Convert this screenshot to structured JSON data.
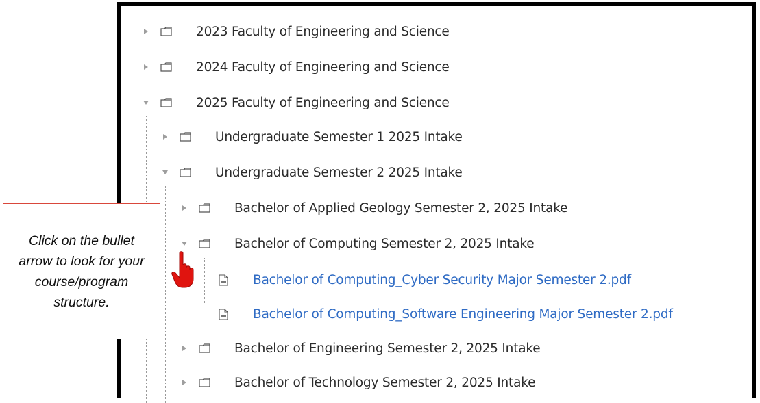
{
  "tree": {
    "items": [
      {
        "label": "2023 Faculty of Engineering and Science",
        "expanded": false,
        "type": "folder"
      },
      {
        "label": "2024 Faculty of Engineering and Science",
        "expanded": false,
        "type": "folder"
      },
      {
        "label": "2025 Faculty of Engineering and Science",
        "expanded": true,
        "type": "folder"
      },
      {
        "label": "Undergraduate Semester 1 2025 Intake",
        "expanded": false,
        "type": "folder"
      },
      {
        "label": "Undergraduate Semester 2 2025 Intake",
        "expanded": true,
        "type": "folder"
      },
      {
        "label": "Bachelor of Applied Geology Semester 2, 2025 Intake",
        "expanded": false,
        "type": "folder"
      },
      {
        "label": "Bachelor of Computing Semester 2, 2025 Intake",
        "expanded": true,
        "type": "folder"
      },
      {
        "label": "Bachelor of Computing_Cyber Security Major Semester 2.pdf",
        "type": "pdf"
      },
      {
        "label": "Bachelor of Computing_Software Engineering Major Semester 2.pdf",
        "type": "pdf"
      },
      {
        "label": "Bachelor of Engineering Semester 2, 2025 Intake",
        "expanded": false,
        "type": "folder"
      },
      {
        "label": "Bachelor of Technology Semester 2, 2025 Intake",
        "expanded": false,
        "type": "folder"
      }
    ]
  },
  "callout": {
    "text": "Click on the bullet arrow to look for your course/program structure."
  },
  "icons": {
    "collapsed": "triangle-right-icon",
    "expanded": "triangle-down-icon",
    "folder": "folder-icon",
    "pdf": "pdf-file-icon",
    "pointer": "hand-pointer-icon"
  },
  "colors": {
    "link": "#2f6bc4",
    "callout_border": "#d9473b",
    "pointer": "#e0140f"
  }
}
